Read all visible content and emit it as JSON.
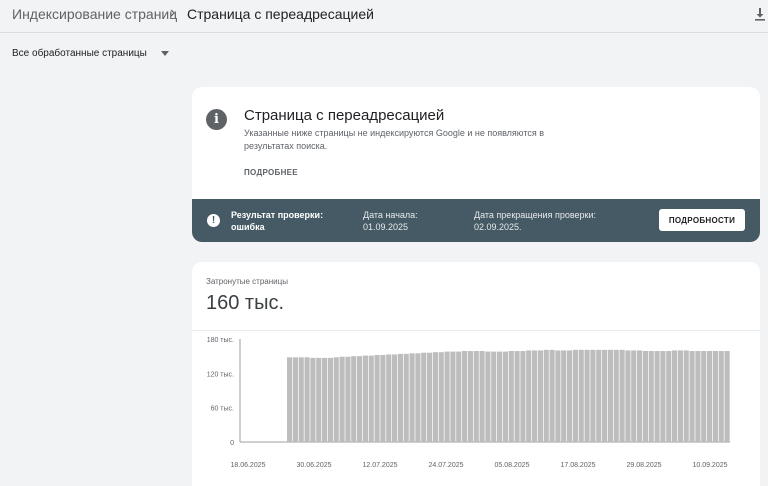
{
  "header": {
    "breadcrumb_root": "Индексирование страниц",
    "breadcrumb_separator": "›",
    "breadcrumb_current": "Страница с переадресацией",
    "download_icon": "download-icon"
  },
  "filter": {
    "label": "Все обработанные страницы"
  },
  "info": {
    "icon": "info-icon",
    "title": "Страница с переадресацией",
    "description": "Указанные ниже страницы не индексируются Google и не появляются в результатах поиска.",
    "more_label": "ПОДРОБНЕЕ"
  },
  "status": {
    "icon": "error-icon",
    "result_label": "Результат проверки: ошибка",
    "start_label": "Дата начала: 01.09.2025",
    "end_label": "Дата прекращения проверки: 02.09.2025.",
    "details_button": "ПОДРОБНОСТИ",
    "bar_color": "#455a64"
  },
  "affected": {
    "label": "Затронутые страницы",
    "value": "160 тыс."
  },
  "chart_data": {
    "type": "bar",
    "y_tick_labels": [
      "180 тыс.",
      "120 тыс.",
      "60 тыс.",
      "0"
    ],
    "y_tick_values": [
      180000,
      120000,
      60000,
      0
    ],
    "x_tick_labels": [
      "18.06.2025",
      "30.06.2025",
      "12.07.2025",
      "24.07.2025",
      "05.08.2025",
      "17.08.2025",
      "29.08.2025",
      "10.09.2025"
    ],
    "ylim": [
      0,
      180000
    ],
    "bar_color": "#bdbdbd",
    "values": [
      0,
      0,
      0,
      0,
      0,
      0,
      0,
      0,
      148000,
      148000,
      148000,
      148000,
      147000,
      147000,
      147000,
      147000,
      148000,
      149000,
      149000,
      150000,
      150000,
      151000,
      151000,
      152000,
      152000,
      153000,
      153000,
      154000,
      154000,
      155000,
      155000,
      156000,
      156000,
      157000,
      157000,
      158000,
      158000,
      158000,
      159000,
      159000,
      159000,
      159000,
      158000,
      158000,
      158000,
      158000,
      159000,
      159000,
      159000,
      160000,
      160000,
      160000,
      161000,
      161000,
      160000,
      160000,
      160000,
      161000,
      161000,
      161000,
      161000,
      161000,
      161000,
      161000,
      161000,
      161000,
      160000,
      160000,
      160000,
      159000,
      159000,
      159000,
      159000,
      159000,
      160000,
      160000,
      160000,
      159000,
      159000,
      159000,
      159000,
      159000,
      159000,
      159000
    ]
  }
}
